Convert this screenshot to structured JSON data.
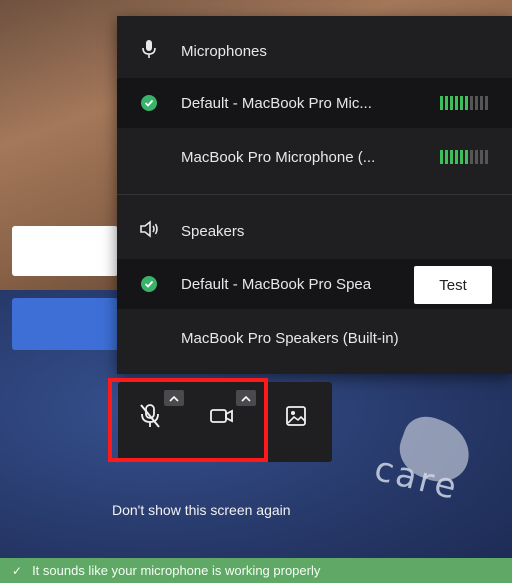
{
  "menu": {
    "microphones_header": "Microphones",
    "microphones": [
      {
        "label": "Default - MacBook Pro Mic...",
        "selected": true,
        "level": 0.55
      },
      {
        "label": "MacBook Pro Microphone (...",
        "selected": false,
        "level": 0.55
      }
    ],
    "speakers_header": "Speakers",
    "speakers": [
      {
        "label": "Default - MacBook Pro Spea",
        "selected": true
      },
      {
        "label": "MacBook Pro Speakers (Built-in)",
        "selected": false
      }
    ],
    "test_label": "Test"
  },
  "controls": {
    "mic_icon": "mic-off-icon",
    "camera_icon": "camera-icon",
    "background_icon": "image-icon"
  },
  "dont_show_label": "Don't show this screen again",
  "status_text": "It sounds like your microphone is working properly",
  "colors": {
    "accent_green": "#3ab36a",
    "status_green": "#5fa866",
    "highlight_red": "#ff1a1a",
    "menu_bg": "#1f1f22"
  }
}
